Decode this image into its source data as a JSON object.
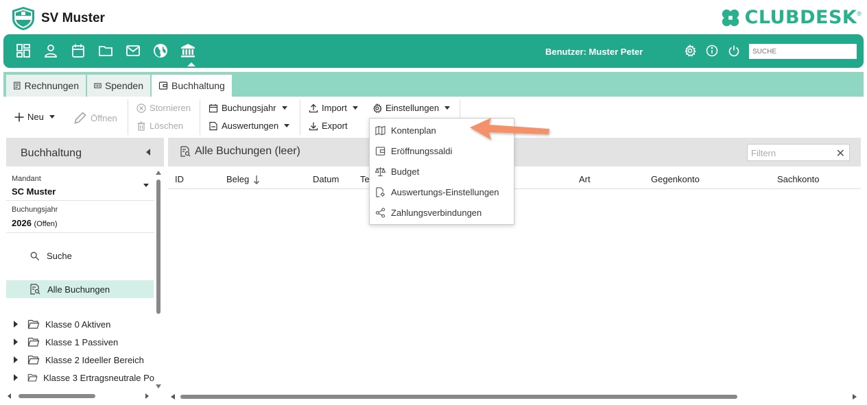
{
  "header": {
    "club_name": "SV Muster",
    "logo_text": "SV MUSTER",
    "brand": "CLUBDESK",
    "brand_reg": "®"
  },
  "navbar": {
    "icons": [
      "dashboard-icon",
      "person-icon",
      "calendar-icon",
      "folder-icon",
      "mail-icon",
      "globe-icon",
      "bank-icon"
    ],
    "user_label": "Benutzer: Muster Peter",
    "search_placeholder": "SUCHE"
  },
  "tabs": [
    {
      "label": "Rechnungen",
      "icon": "invoice-icon"
    },
    {
      "label": "Spenden",
      "icon": "donation-icon"
    },
    {
      "label": "Buchhaltung",
      "icon": "wallet-icon",
      "active": true
    }
  ],
  "toolbar": {
    "new": "Neu",
    "open": "Öffnen",
    "cancel": "Stornieren",
    "delete": "Löschen",
    "fiscal_year": "Buchungsjahr",
    "reports": "Auswertungen",
    "import": "Import",
    "export": "Export",
    "settings": "Einstellungen"
  },
  "settings_menu": [
    {
      "label": "Kontenplan",
      "icon": "map-icon"
    },
    {
      "label": "Eröffnungssaldi",
      "icon": "wallet-icon"
    },
    {
      "label": "Budget",
      "icon": "scale-icon"
    },
    {
      "label": "Auswertungs-Einstellungen",
      "icon": "report-settings-icon"
    },
    {
      "label": "Zahlungsverbindungen",
      "icon": "share-icon"
    }
  ],
  "sidebar": {
    "title": "Buchhaltung",
    "client_label": "Mandant",
    "client_value": "SC Muster",
    "year_label": "Buchungsjahr",
    "year_value": "2026",
    "year_status": "(Offen)",
    "search": "Suche",
    "all_bookings": "Alle Buchungen",
    "tree": [
      "Klasse 0 Aktiven",
      "Klasse 1 Passiven",
      "Klasse 2 Ideeller Bereich",
      "Klasse 3 Ertragsneutrale Po"
    ]
  },
  "main": {
    "title": "Alle Buchungen (leer)",
    "filter_placeholder": "Filtern",
    "columns": [
      "ID",
      "Beleg",
      "Datum",
      "Te",
      "Art",
      "Gegenkonto",
      "Sachkonto"
    ]
  },
  "colors": {
    "primary": "#22a88a",
    "tab_strip": "#8fd6c3",
    "selection": "#d3efe7",
    "annotation_arrow": "#f4906a"
  }
}
